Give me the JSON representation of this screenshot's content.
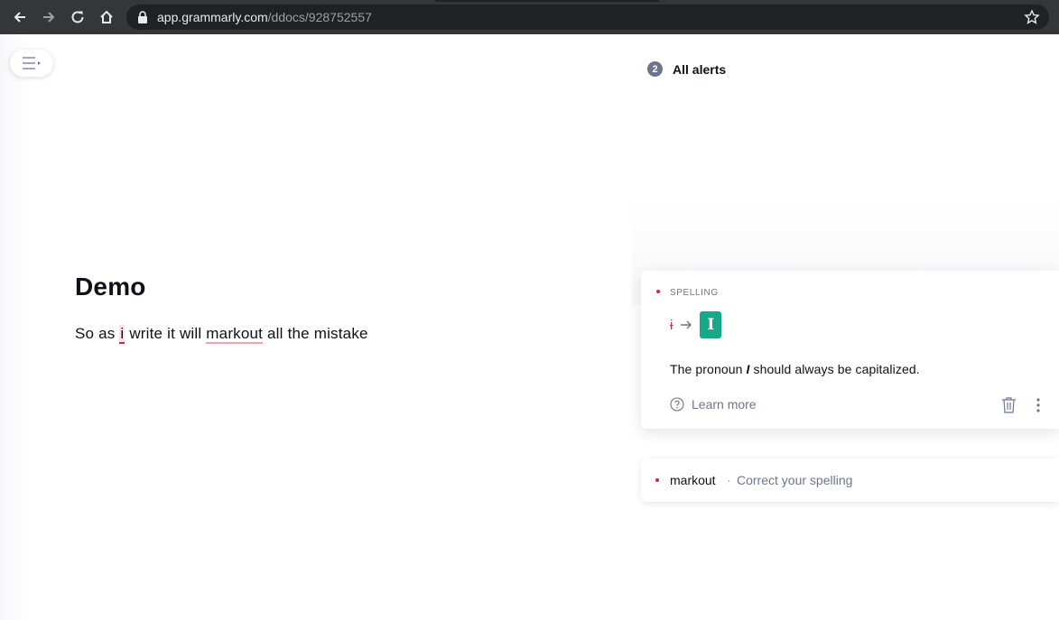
{
  "browser": {
    "url_host": "app.grammarly.com",
    "url_path": "/ddocs/928752557"
  },
  "document": {
    "title": "Demo",
    "text_before": "So as ",
    "error_word": "i",
    "text_middle": " write it will ",
    "error_word_2": "markout",
    "text_after": " all the mistake"
  },
  "alerts": {
    "count": "2",
    "title": "All alerts"
  },
  "card": {
    "category": "SPELLING",
    "original": "i",
    "suggestion": "I",
    "desc_before": "The pronoun ",
    "desc_emph": "I",
    "desc_after": " should always be capitalized.",
    "learn_more": "Learn more"
  },
  "card2": {
    "word": "markout",
    "separator": "·",
    "hint": "Correct your spelling"
  },
  "colors": {
    "error": "#d92046",
    "accept": "#15a889",
    "chrome": "#35363a"
  }
}
